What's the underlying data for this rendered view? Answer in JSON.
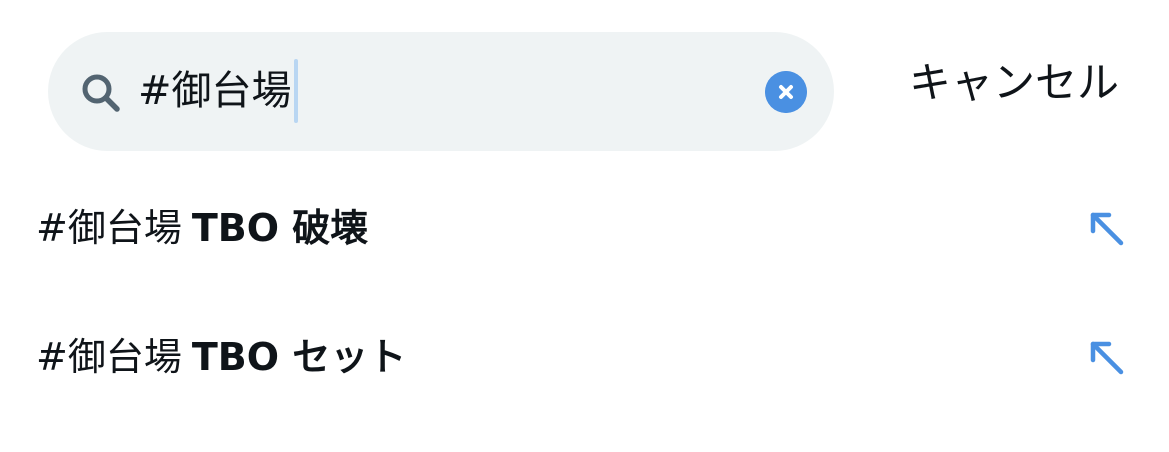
{
  "search": {
    "value": "#御台場",
    "icon": "search-icon",
    "clear_icon": "clear-icon"
  },
  "header": {
    "cancel_label": "キャンセル"
  },
  "suggestions": [
    {
      "prefix": "#御台場",
      "completion": "TBO 破壊",
      "icon": "arrow-up-left-icon"
    },
    {
      "prefix": "#御台場",
      "completion": "TBO セット",
      "icon": "arrow-up-left-icon"
    }
  ],
  "colors": {
    "search_bg": "#eff3f4",
    "accent": "#4a90e2",
    "text": "#0f1419",
    "caret": "#b9d6f2"
  }
}
